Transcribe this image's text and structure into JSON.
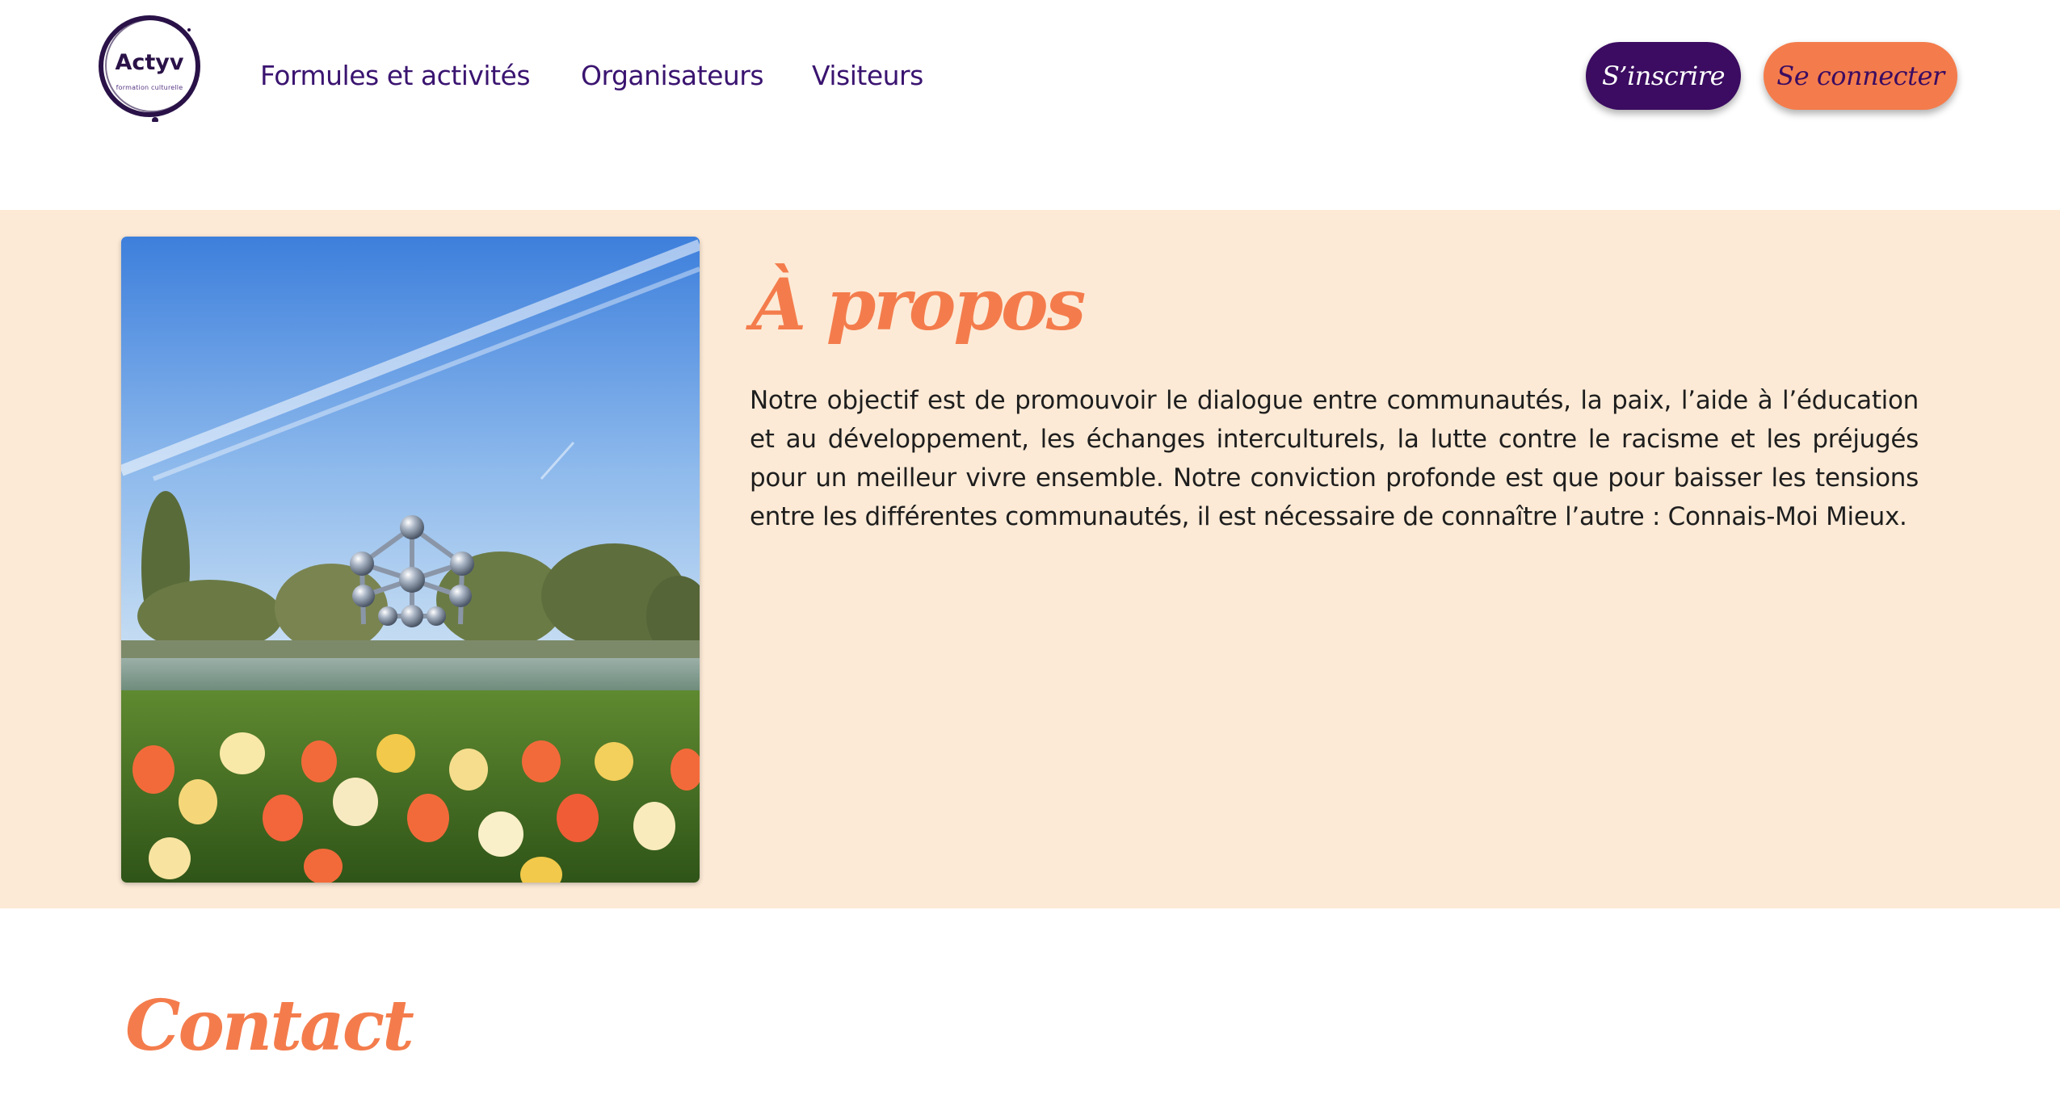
{
  "brand": {
    "name": "Actyv",
    "tagline": "formation culturelle",
    "colors": {
      "primary": "#3b0c61",
      "accent": "#f47c4c",
      "section_bg": "#fcead6"
    }
  },
  "nav": {
    "items": [
      {
        "label": "Formules et activités"
      },
      {
        "label": "Organisateurs"
      },
      {
        "label": "Visiteurs"
      }
    ]
  },
  "auth": {
    "signup_label": "S’inscrire",
    "login_label": "Se connecter"
  },
  "about": {
    "title": "À propos",
    "body": "Notre objectif est de promouvoir le dialogue entre communautés, la paix, l’aide à l’éducation et au développement, les échanges interculturels, la lutte contre le racisme et les préjugés pour un meilleur vivre ensemble. Notre conviction profonde est que pour baisser les tensions entre les différentes communautés, il est nécessaire de connaître l’autre : Connais-Moi Mieux.",
    "image": "atomium-photo"
  },
  "contact": {
    "title": "Contact"
  }
}
